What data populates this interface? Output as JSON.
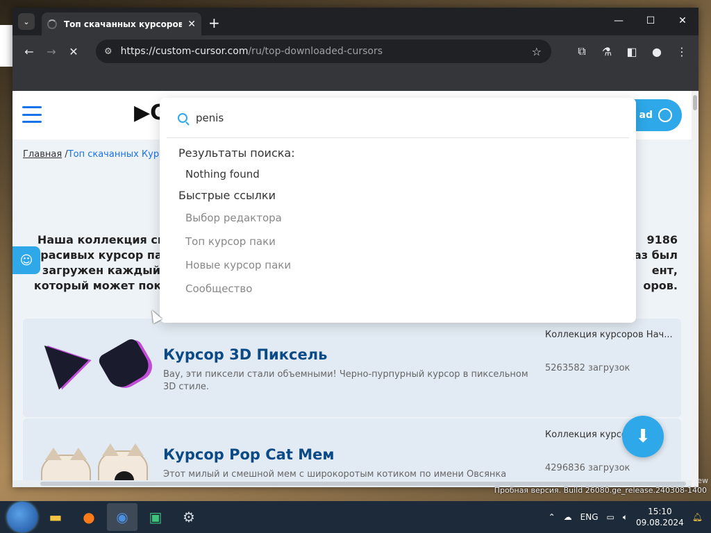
{
  "browser": {
    "tab_title": "Топ скачанных курсоров - Cu",
    "url_host": "https://custom-cursor.com",
    "url_path": "/ru/top-downloaded-cursors"
  },
  "page": {
    "logo_text": "C",
    "download_button_label": "ad",
    "breadcrumb": {
      "home": "Главная",
      "separator": "/",
      "current": "Топ скачанных Курс"
    },
    "intro_left": "Наша коллекция си красивых курсор пак загружен каждый который может пока",
    "intro_right": "9186 аз был ент, оров."
  },
  "search": {
    "query": "penis",
    "results_heading": "Результаты поиска:",
    "no_results": "Nothing found",
    "quick_links_heading": "Быстрые ссылки",
    "quick_links": [
      "Выбор редактора",
      "Топ курсор паки",
      "Новые курсор паки",
      "Сообщество"
    ]
  },
  "cards": [
    {
      "title": "Курсор 3D Пиксель",
      "description": "Вау, эти пиксели стали объемными! Черно-пурпурный курсор в пиксельном 3D стиле.",
      "collection": "Коллекция курсоров Нач...",
      "downloads": "5263582 загрузок"
    },
    {
      "title": "Курсор Pop Cat Мем",
      "description": "Этот милый и смешной мем с широкоротым котиком по имени Овсянка",
      "collection": "Коллекция курсо...",
      "downloads": "4296836 загрузок"
    }
  ],
  "system": {
    "watermark_top": "ew",
    "watermark": "Пробная версия. Build 26080.ge_release.240308-1400",
    "lang": "ENG",
    "time": "15:10",
    "date": "09.08.2024"
  },
  "colors": {
    "accent": "#2ea8e8",
    "title_blue": "#0c4a86",
    "chrome_dark": "#202124"
  }
}
